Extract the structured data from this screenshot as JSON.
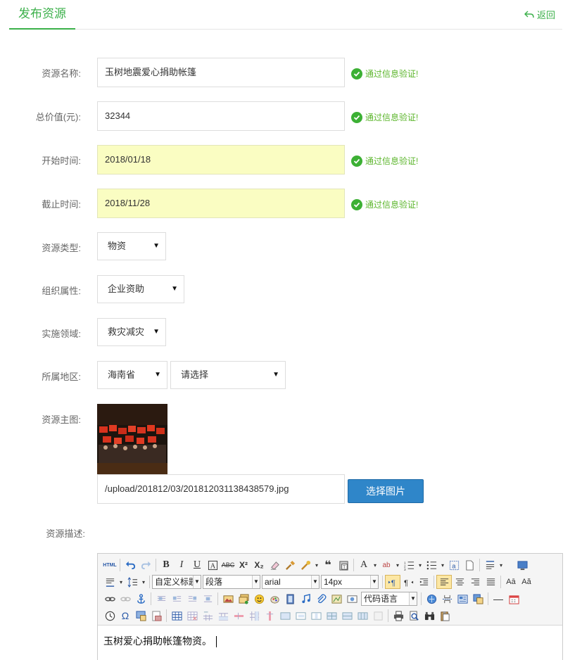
{
  "header": {
    "tab_title": "发布资源",
    "back_label": "返回"
  },
  "validation_text": "通过信息验证!",
  "form": {
    "name": {
      "label": "资源名称:",
      "value": "玉树地震爱心捐助帐篷"
    },
    "value": {
      "label": "总价值(元):",
      "value": "32344"
    },
    "start": {
      "label": "开始时间:",
      "value": "2018/01/18"
    },
    "end": {
      "label": "截止时间:",
      "value": "2018/11/28"
    },
    "type": {
      "label": "资源类型:",
      "value": "物资"
    },
    "org": {
      "label": "组织属性:",
      "value": "企业资助"
    },
    "field": {
      "label": "实施领域:",
      "value": "救灾减灾"
    },
    "region": {
      "label": "所属地区:",
      "province": "海南省",
      "city": "请选择"
    },
    "image": {
      "label": "资源主图:",
      "path": "/upload/201812/03/201812031138438579.jpg",
      "button": "选择图片"
    },
    "desc": {
      "label": "资源描述:"
    }
  },
  "editor": {
    "html_btn": "HTML",
    "custom_title": "自定义标题",
    "paragraph": "段落",
    "font": "arial",
    "size": "14px",
    "code_lang": "代码语言",
    "content": "玉树爱心捐助帐篷物资。"
  },
  "colors": {
    "accent": "#3bb04a",
    "button": "#2f86c9",
    "highlight": "#fafdc2"
  }
}
